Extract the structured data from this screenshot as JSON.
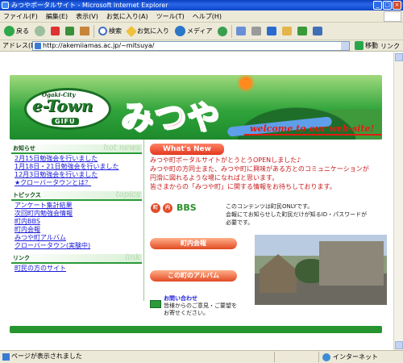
{
  "window": {
    "title": "みつやポータルサイト - Microsoft Internet Explorer"
  },
  "menu": [
    "ファイル(F)",
    "編集(E)",
    "表示(V)",
    "お気に入り(A)",
    "ツール(T)",
    "ヘルプ(H)"
  ],
  "toolbar": {
    "back": "戻る",
    "search": "検索",
    "favorites": "お気に入り",
    "media": "メディア"
  },
  "address": {
    "label": "アドレス(D)",
    "url": "http://akemiiamas.ac.jp/~mitsuya/",
    "go": "移動",
    "links": "リンク"
  },
  "banner": {
    "logo_top": "Ogaki-City",
    "logo_main": "e-Town",
    "logo_bottom": "GIFU",
    "title": "みつや",
    "welcome": "welcome to our web-site!"
  },
  "sections": {
    "news": {
      "heading": "お知らせ",
      "watermark": "hot news",
      "items": [
        "2月15日勉強会を行いました",
        "1月18日・21日勉強会を行いました",
        "12月3日勉強会を行いました",
        "★クローバータウンとは？"
      ]
    },
    "topics": {
      "heading": "トピックス",
      "watermark": "topics",
      "items": [
        "アンケート集計結果",
        "次回町内勉強会情報",
        "町内BBS",
        "町内会報",
        "みつや町アルバム",
        "クローバータウン(実験中)"
      ]
    },
    "links": {
      "heading": "リンク",
      "watermark": "link",
      "items": [
        "町民の方のサイト"
      ]
    }
  },
  "whats_new": {
    "heading": "What's New",
    "lines": [
      "みつや町ポータルサイトがとうとうOPENしました♪",
      "みつや町の方同士また、みつや町に興味がある方とのコミュニケーションが",
      "円滑に図れるような場になればと思います。",
      "皆さまからの「みつや町」に関する情報をお待ちしております。"
    ]
  },
  "bbs": {
    "badge1": "町",
    "badge2": "内",
    "label": "BBS",
    "note_lines": [
      "このコンテンツは町民ONLYです。",
      "会報にてお知らせした町民だけが知るID・パスワードが",
      "必要です。"
    ]
  },
  "buttons": {
    "kaihou": "町内会報",
    "album": "この町のアルバム"
  },
  "contact": {
    "label": "お問い合わせ",
    "lines": [
      "皆様からのご意見・ご要望を",
      "お寄せください。"
    ]
  },
  "status": {
    "text": "ページが表示されました",
    "zone": "インターネット"
  }
}
